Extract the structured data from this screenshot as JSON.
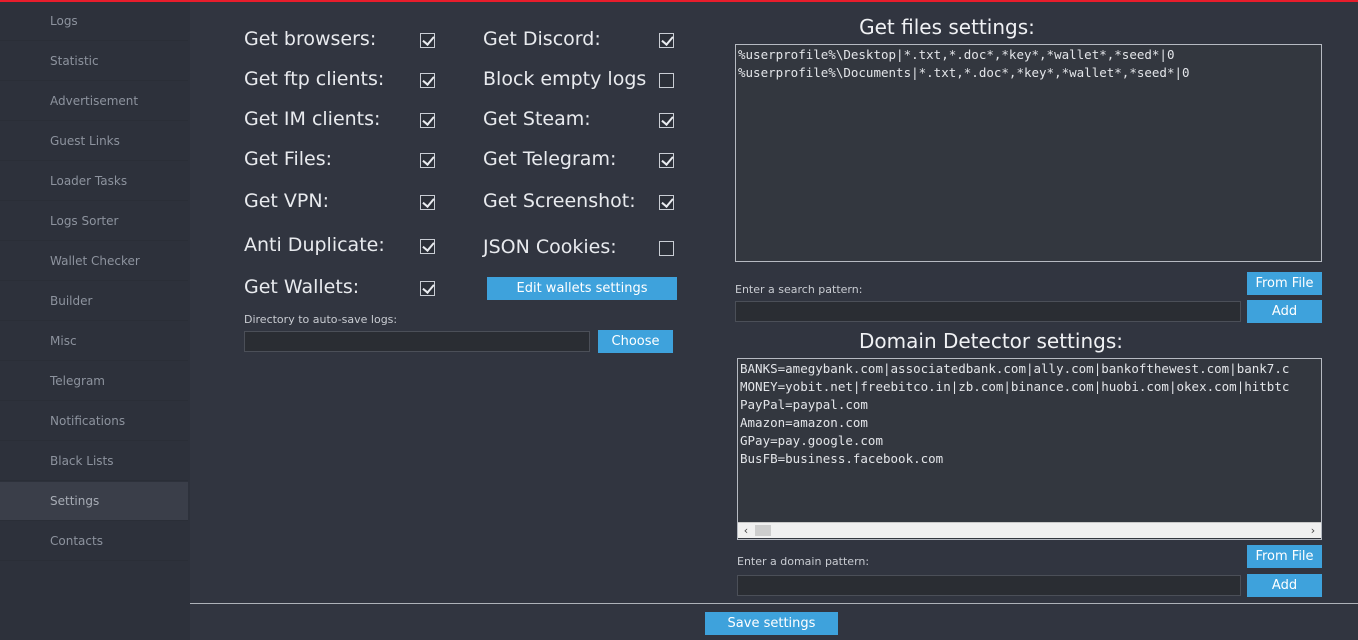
{
  "sidebar": {
    "items": [
      {
        "label": "Logs"
      },
      {
        "label": "Statistic"
      },
      {
        "label": "Advertisement"
      },
      {
        "label": "Guest Links"
      },
      {
        "label": "Loader Tasks"
      },
      {
        "label": "Logs Sorter"
      },
      {
        "label": "Wallet Checker"
      },
      {
        "label": "Builder"
      },
      {
        "label": "Misc"
      },
      {
        "label": "Telegram"
      },
      {
        "label": "Notifications"
      },
      {
        "label": "Black Lists"
      },
      {
        "label": "Settings"
      },
      {
        "label": "Contacts"
      }
    ],
    "active": "Settings"
  },
  "options": {
    "get_browsers": {
      "label": "Get browsers:",
      "checked": true
    },
    "get_ftp": {
      "label": "Get ftp clients:",
      "checked": true
    },
    "get_im": {
      "label": "Get IM clients:",
      "checked": true
    },
    "get_files": {
      "label": "Get Files:",
      "checked": true
    },
    "get_vpn": {
      "label": "Get VPN:",
      "checked": true
    },
    "anti_duplicate": {
      "label": "Anti Duplicate:",
      "checked": true
    },
    "get_wallets": {
      "label": "Get Wallets:",
      "checked": true
    },
    "get_discord": {
      "label": "Get Discord:",
      "checked": true
    },
    "block_empty": {
      "label": "Block empty logs",
      "checked": false
    },
    "get_steam": {
      "label": "Get Steam:",
      "checked": true
    },
    "get_telegram": {
      "label": "Get Telegram:",
      "checked": true
    },
    "get_screenshot": {
      "label": "Get Screenshot:",
      "checked": true
    },
    "json_cookies": {
      "label": "JSON Cookies:",
      "checked": false
    }
  },
  "edit_wallets_button": "Edit wallets settings",
  "autosave": {
    "label": "Directory to auto-save logs:",
    "value": "",
    "choose_button": "Choose"
  },
  "files_settings": {
    "title": "Get files settings:",
    "lines": [
      "%userprofile%\\Desktop|*.txt,*.doc*,*key*,*wallet*,*seed*|0",
      "%userprofile%\\Documents|*.txt,*.doc*,*key*,*wallet*,*seed*|0"
    ],
    "from_file_button": "From File",
    "pattern_label": "Enter a search pattern:",
    "pattern_value": "",
    "add_button": "Add"
  },
  "domain_settings": {
    "title": "Domain Detector settings:",
    "lines": [
      "BANKS=amegybank.com|associatedbank.com|ally.com|bankofthewest.com|bank7.c",
      "MONEY=yobit.net|freebitco.in|zb.com|binance.com|huobi.com|okex.com|hitbtc",
      "PayPal=paypal.com",
      "Amazon=amazon.com",
      "GPay=pay.google.com",
      "BusFB=business.facebook.com"
    ],
    "from_file_button": "From File",
    "pattern_label": "Enter a domain pattern:",
    "pattern_value": "",
    "add_button": "Add"
  },
  "save_button": "Save settings",
  "colors": {
    "accent": "#3ea2dc",
    "background": "#313540",
    "sidebar": "#2d313b",
    "top_bar": "#e81d2c"
  }
}
